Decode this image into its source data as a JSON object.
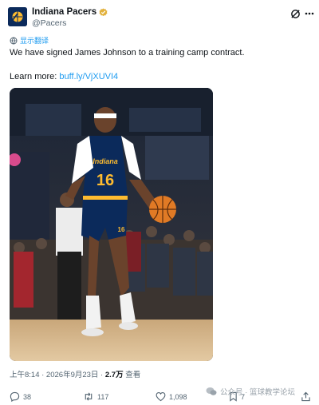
{
  "account": {
    "display_name": "Indiana Pacers",
    "handle": "@Pacers"
  },
  "translate_label": "显示翻译",
  "tweet": {
    "text": "We have signed James Johnson to a training camp contract.",
    "learn_more_prefix": "Learn more: ",
    "link_text": "buff.ly/VjXUVI4"
  },
  "media": {
    "jersey_wordmark": "Indiana",
    "jersey_number": "16",
    "shorts_number": "16"
  },
  "meta": {
    "timestamp": "上午8:14 · 2026年9月23日 · ",
    "views": "2.7万",
    "views_suffix": " 查看"
  },
  "actions": {
    "replies": "38",
    "reposts": "117",
    "likes": "1,098",
    "bookmarks": "7"
  },
  "watermark": "公众号 · 篮球教学论坛",
  "colors": {
    "link": "#1d9bf0",
    "secondary_text": "#536471",
    "verified_badge": "#e2b13c",
    "team_navy": "#0b2a5b",
    "team_gold": "#fdbb30"
  }
}
